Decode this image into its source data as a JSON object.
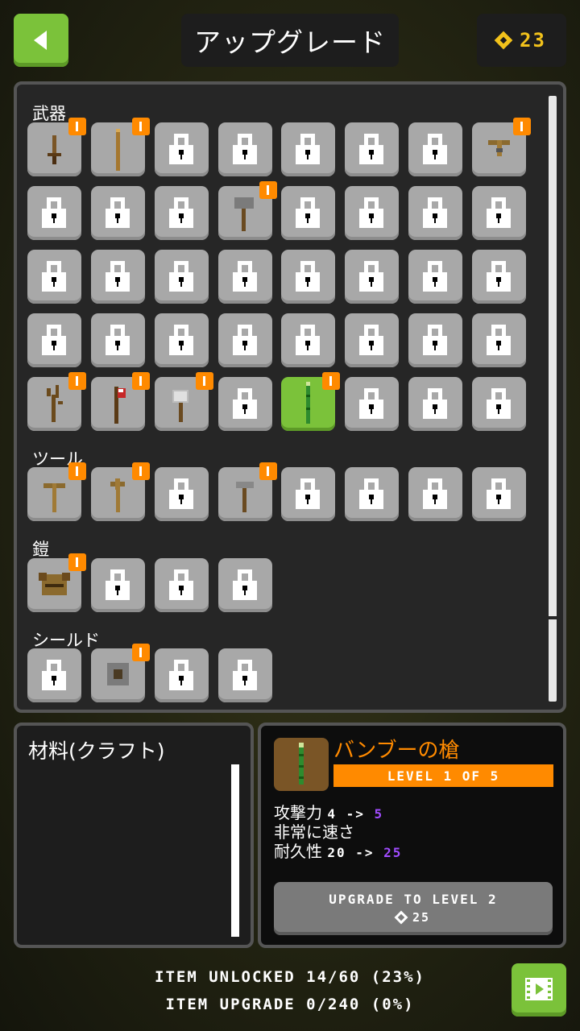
{
  "header": {
    "back_icon": "back-arrow-icon",
    "title": "アップグレード",
    "gems": "23",
    "gem_icon": "diamond-gem-icon"
  },
  "categories": [
    {
      "label": "武器",
      "slots": [
        "short-sword",
        "wooden-staff",
        "lock",
        "lock",
        "lock",
        "lock",
        "lock",
        "crossbow",
        "lock",
        "lock",
        "lock",
        "stone-hammer",
        "lock",
        "lock",
        "lock",
        "lock",
        "lock",
        "lock",
        "lock",
        "lock",
        "lock",
        "lock",
        "lock",
        "lock",
        "lock",
        "lock",
        "lock",
        "lock",
        "lock",
        "lock",
        "lock",
        "lock",
        "branch-club",
        "red-axe",
        "stone-axe",
        "lock",
        "bamboo-spear",
        "lock",
        "lock",
        "lock"
      ]
    },
    {
      "label": "ツール",
      "slots": [
        "wooden-pickaxe",
        "wooden-shovel",
        "lock",
        "stone-pick",
        "lock",
        "lock",
        "lock",
        "lock"
      ]
    },
    {
      "label": "鎧",
      "slots": [
        "leather-armor",
        "lock",
        "lock",
        "lock"
      ]
    },
    {
      "label": "シールド",
      "slots": [
        "lock",
        "wooden-shield",
        "lock",
        "lock"
      ]
    }
  ],
  "badges": {
    "weapons": [
      0,
      1,
      7,
      11,
      32,
      33,
      34,
      36
    ],
    "tools": [
      0,
      1,
      3
    ],
    "armor": [
      0
    ],
    "shields": [
      1
    ]
  },
  "selected": {
    "category": 0,
    "index": 36
  },
  "materials": {
    "title": "材料(クラフト)"
  },
  "detail": {
    "name": "バンブーの槍",
    "level_text": "LEVEL 1 OF 5",
    "stats": [
      {
        "label": "攻撃力",
        "from": "4",
        "arrow": "->",
        "to": "5"
      },
      {
        "label": "非常に速さ"
      },
      {
        "label": "耐久性",
        "from": "20",
        "arrow": "->",
        "to": "25"
      }
    ],
    "upgrade_label": "UPGRADE TO LEVEL 2",
    "upgrade_cost": "25"
  },
  "footer": {
    "unlocked": "ITEM UNLOCKED 14/60 (23%)",
    "upgrade": "ITEM UPGRADE 0/240 (0%)",
    "video_icon": "video-film-icon"
  },
  "colors": {
    "accent_green": "#7bc23a",
    "orange": "#ff8a00",
    "gem_yellow": "#f2c21b",
    "purple": "#a14cff",
    "slot_gray": "#a8a8a8"
  }
}
